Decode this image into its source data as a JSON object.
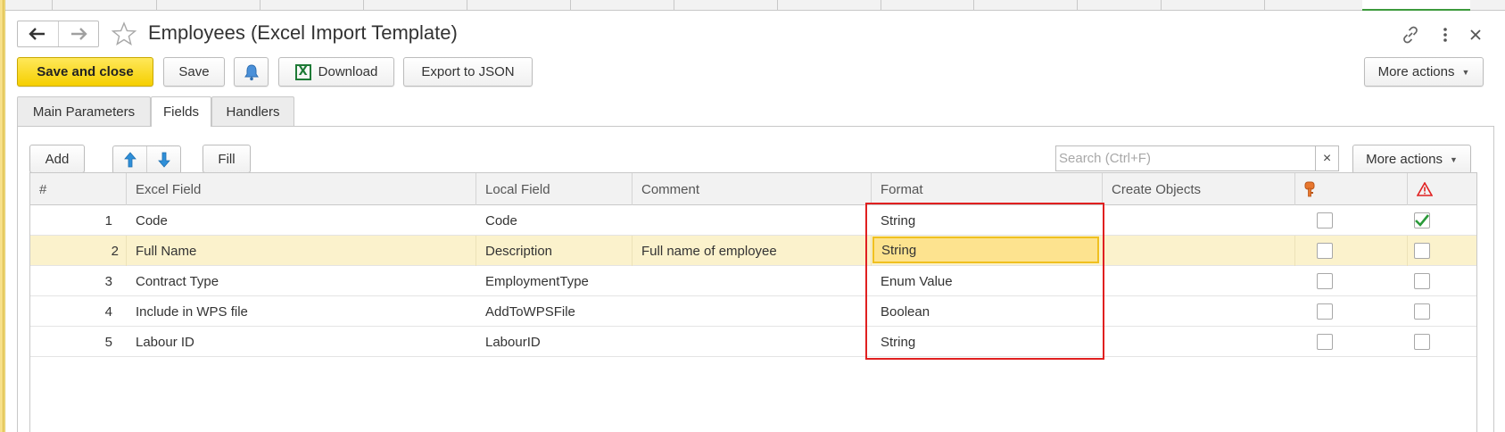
{
  "window": {
    "title": "Employees (Excel Import Template)"
  },
  "toolbar": {
    "save_and_close": "Save and close",
    "save": "Save",
    "download": "Download",
    "export_json": "Export to JSON",
    "more_actions": "More actions"
  },
  "tabs": [
    {
      "label": "Main Parameters",
      "active": false
    },
    {
      "label": "Fields",
      "active": true
    },
    {
      "label": "Handlers",
      "active": false
    }
  ],
  "fields_toolbar": {
    "add": "Add",
    "fill": "Fill",
    "search_placeholder": "Search (Ctrl+F)",
    "search_clear": "×",
    "more_actions": "More actions"
  },
  "table": {
    "columns": [
      "#",
      "Excel Field",
      "Local Field",
      "Comment",
      "Format",
      "Create Objects"
    ],
    "rows": [
      {
        "num": "1",
        "excel_field": "Code",
        "local_field": "Code",
        "comment": "",
        "format": "String",
        "create_objects": "",
        "key": false,
        "required": true
      },
      {
        "num": "2",
        "excel_field": "Full Name",
        "local_field": "Description",
        "comment": "Full name of employee",
        "format": "String",
        "create_objects": "",
        "key": false,
        "required": false
      },
      {
        "num": "3",
        "excel_field": "Contract Type",
        "local_field": "EmploymentType",
        "comment": "",
        "format": "Enum Value",
        "create_objects": "",
        "key": false,
        "required": false
      },
      {
        "num": "4",
        "excel_field": "Include in WPS file",
        "local_field": "AddToWPSFile",
        "comment": "",
        "format": "Boolean",
        "create_objects": "",
        "key": false,
        "required": false
      },
      {
        "num": "5",
        "excel_field": "Labour ID",
        "local_field": "LabourID",
        "comment": "",
        "format": "String",
        "create_objects": "",
        "key": false,
        "required": false
      }
    ],
    "selected_row_index": 1,
    "key_icon": "key-icon",
    "warning_icon": "warning-icon"
  },
  "colors": {
    "primary_button": "#f5cf00",
    "selected_row": "#fbf2cc",
    "focus_cell": "#fde38f",
    "annotation_box": "#e02020",
    "check_green": "#2a9a3a",
    "arrow_blue": "#2f8fd8"
  }
}
